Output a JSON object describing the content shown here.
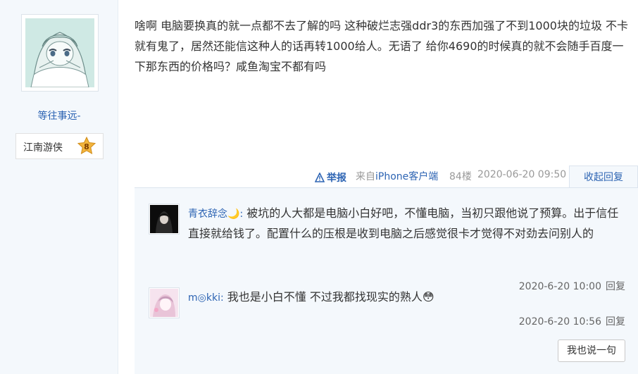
{
  "author": {
    "name": "等往事远-",
    "badge_title": "江南游侠",
    "badge_level": "8"
  },
  "post": {
    "body": "啥啊 电脑要换真的就一点都不去了解的吗 这种破烂志强ddr3的东西加强了不到1000块的垃圾 不卡就有鬼了，居然还能信这种人的话再转1000给人。无语了 给你4690的时候真的就不会随手百度一下那东西的价格吗？咸鱼淘宝不都有吗"
  },
  "tail": {
    "report": "举报",
    "from_prefix": "来自",
    "device": "iPhone客户端",
    "floor": "84楼",
    "time": "2020-06-20 09:50",
    "collapse": "收起回复"
  },
  "comments": [
    {
      "user": "青衣辞念🌙",
      "sep": ":",
      "text": "被坑的人大都是电脑小白好吧，不懂电脑，当初只跟他说了预算。出于信任直接就给钱了。配置什么的压根是收到电脑之后感觉很卡才觉得不对劲去问别人的",
      "time": "2020-6-20 10:00",
      "reply": "回复"
    },
    {
      "user": "m◎kki",
      "sep": ":",
      "text": "我也是小白不懂 不过我都找现实的熟人😳",
      "time": "2020-6-20 10:56",
      "reply": "回复"
    }
  ],
  "say_button": "我也说一句",
  "colors": {
    "link": "#2d64b3",
    "panel": "#f4f8fc",
    "badge_gold": "#f2b43d"
  }
}
